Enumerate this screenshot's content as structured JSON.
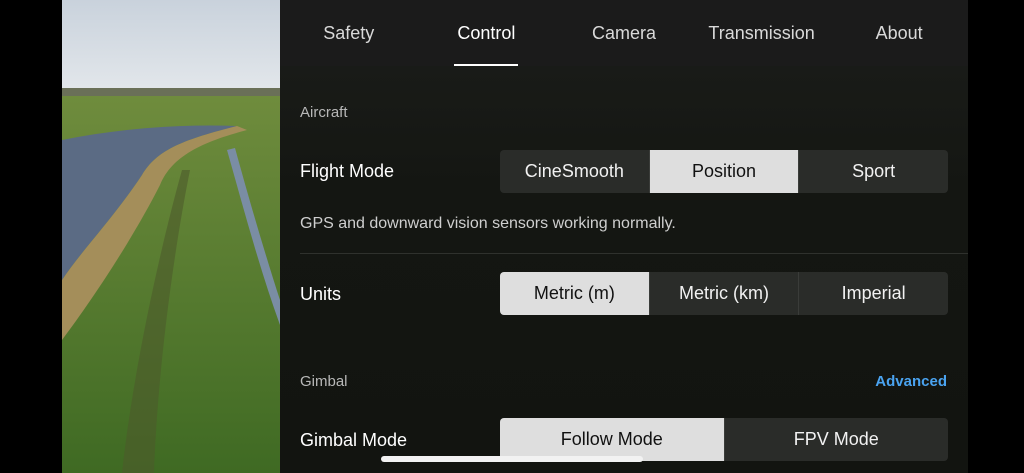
{
  "tabs": [
    {
      "label": "Safety",
      "active": false
    },
    {
      "label": "Control",
      "active": true
    },
    {
      "label": "Camera",
      "active": false
    },
    {
      "label": "Transmission",
      "active": false
    },
    {
      "label": "About",
      "active": false
    }
  ],
  "aircraft": {
    "section_title": "Aircraft",
    "flight_mode": {
      "label": "Flight Mode",
      "options": [
        "CineSmooth",
        "Position",
        "Sport"
      ],
      "selected": "Position"
    },
    "hint": "GPS and downward vision sensors working normally.",
    "units": {
      "label": "Units",
      "options": [
        "Metric (m)",
        "Metric (km)",
        "Imperial"
      ],
      "selected": "Metric (m)"
    }
  },
  "gimbal": {
    "section_title": "Gimbal",
    "advanced_label": "Advanced",
    "gimbal_mode": {
      "label": "Gimbal Mode",
      "options": [
        "Follow Mode",
        "FPV Mode"
      ],
      "selected": "Follow Mode"
    }
  },
  "colors": {
    "accent": "#4aa3f0",
    "selected_segment": "#dedede",
    "segment_bg": "#2a2c29"
  }
}
